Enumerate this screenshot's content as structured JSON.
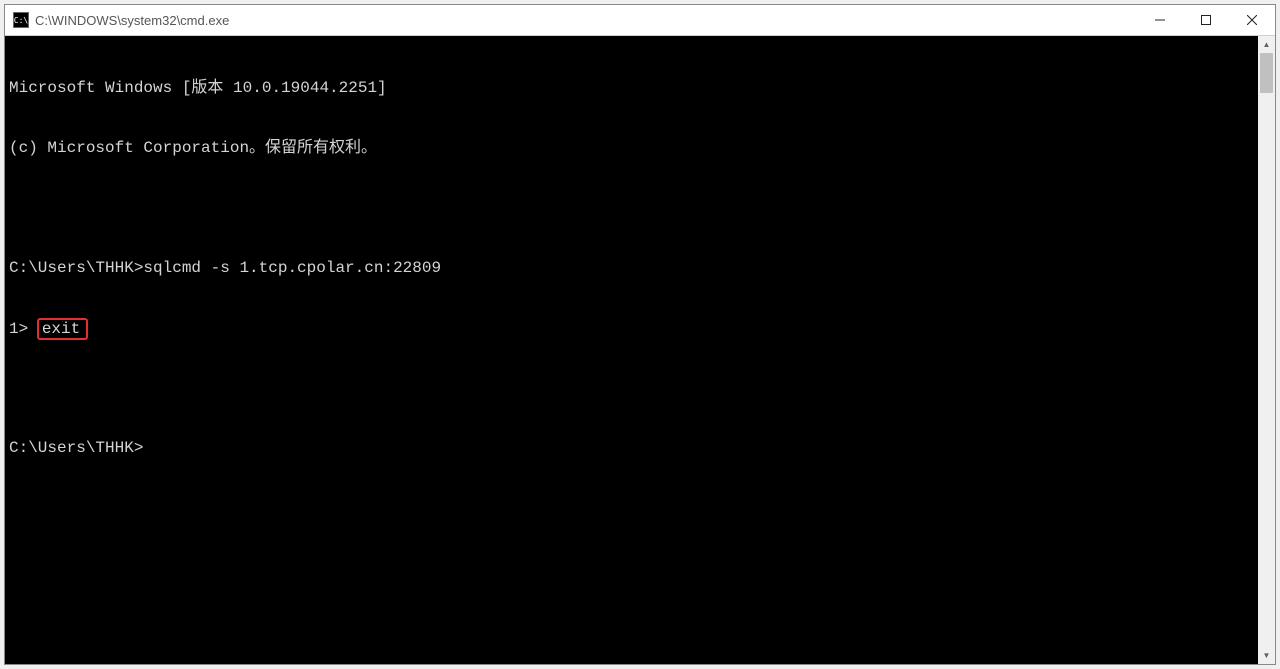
{
  "window": {
    "title": "C:\\WINDOWS\\system32\\cmd.exe",
    "icon_label": "C:\\"
  },
  "terminal": {
    "line1": "Microsoft Windows [版本 10.0.19044.2251]",
    "line2": "(c) Microsoft Corporation。保留所有权利。",
    "blank1": "",
    "prompt1_path": "C:\\Users\\THHK>",
    "prompt1_cmd": "sqlcmd -s 1.tcp.cpolar.cn:22809",
    "sqlcmd_prompt": "1> ",
    "sqlcmd_input": "exit",
    "blank2": "",
    "prompt2_path": "C:\\Users\\THHK>"
  }
}
